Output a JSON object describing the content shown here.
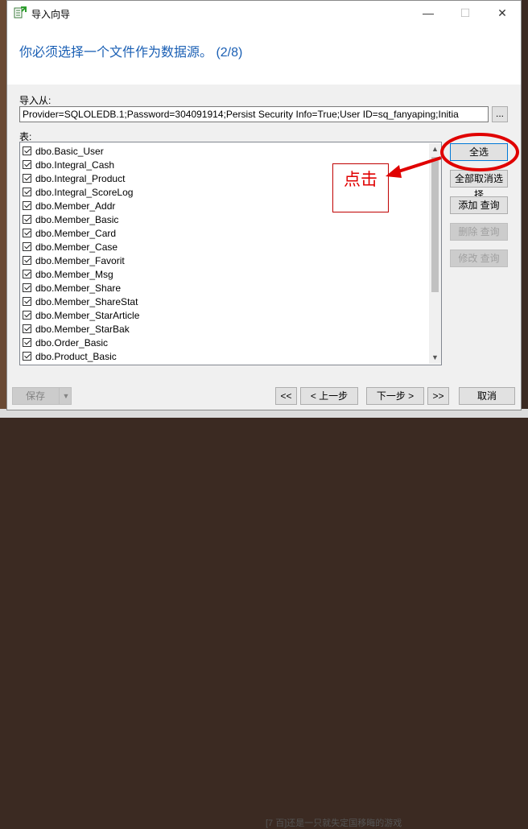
{
  "window": {
    "title": "导入向导",
    "minimize": "—",
    "maximize": "☐",
    "close": "✕"
  },
  "header": {
    "text": "你必须选择一个文件作为数据源。 (2/8)"
  },
  "import_from": {
    "label": "导入从:",
    "value": "Provider=SQLOLEDB.1;Password=304091914;Persist Security Info=True;User ID=sq_fanyaping;Initia",
    "browse_label": "..."
  },
  "tables": {
    "label": "表:",
    "items": [
      {
        "name": "dbo.Basic_User",
        "checked": true
      },
      {
        "name": "dbo.Integral_Cash",
        "checked": true
      },
      {
        "name": "dbo.Integral_Product",
        "checked": true
      },
      {
        "name": "dbo.Integral_ScoreLog",
        "checked": true
      },
      {
        "name": "dbo.Member_Addr",
        "checked": true
      },
      {
        "name": "dbo.Member_Basic",
        "checked": true
      },
      {
        "name": "dbo.Member_Card",
        "checked": true
      },
      {
        "name": "dbo.Member_Case",
        "checked": true
      },
      {
        "name": "dbo.Member_Favorit",
        "checked": true
      },
      {
        "name": "dbo.Member_Msg",
        "checked": true
      },
      {
        "name": "dbo.Member_Share",
        "checked": true
      },
      {
        "name": "dbo.Member_ShareStat",
        "checked": true
      },
      {
        "name": "dbo.Member_StarArticle",
        "checked": true
      },
      {
        "name": "dbo.Member_StarBak",
        "checked": true
      },
      {
        "name": "dbo.Order_Basic",
        "checked": true
      },
      {
        "name": "dbo.Product_Basic",
        "checked": true
      }
    ]
  },
  "side_buttons": {
    "select_all": "全选",
    "deselect_all": "全部取消选择",
    "add_query": "添加 查询",
    "delete_query": "删除 查询",
    "edit_query": "修改 查询"
  },
  "annotation": {
    "text": "点击",
    "color": "#e00000"
  },
  "bottom": {
    "save": "保存",
    "first": "<<",
    "prev": "< 上一步",
    "next": "下一步 >",
    "last": ">>",
    "cancel": "取消"
  },
  "background_text": "[7 百]还是一只就失定国移晦的游戏",
  "colors": {
    "header_text": "#1a5fb4",
    "annotation": "#e00000",
    "default_button_border": "#0078d7"
  }
}
